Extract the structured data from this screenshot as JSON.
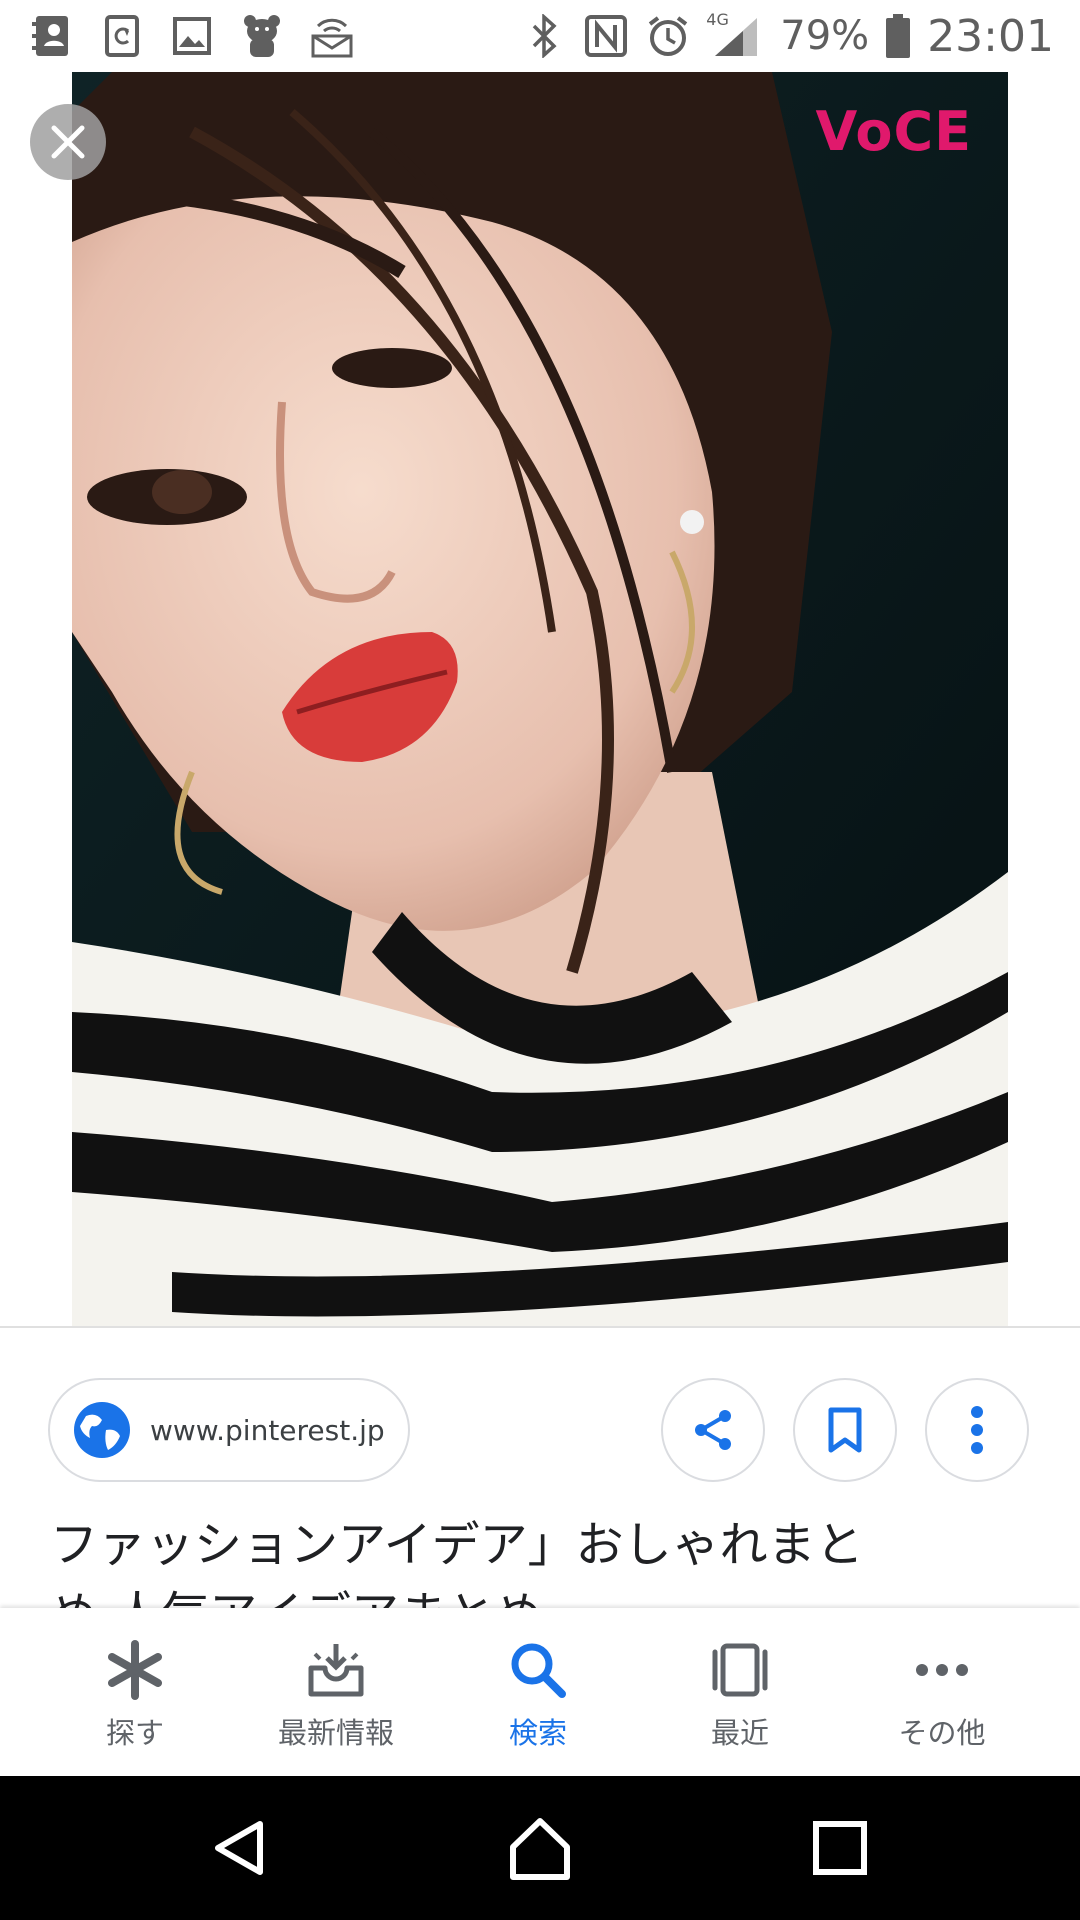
{
  "status_bar": {
    "network": "4G",
    "battery": "79%",
    "time": "23:01"
  },
  "viewer": {
    "brand_text": "VoCE",
    "close_label": "×"
  },
  "source": {
    "domain": "www.pinterest.jp"
  },
  "caption": {
    "line1": "ファッションアイデア」おしゃれまと",
    "line2": "め 人気アイデアまとめ"
  },
  "bottom_nav": {
    "items": [
      {
        "label": "探す",
        "icon": "asterisk-icon"
      },
      {
        "label": "最新情報",
        "icon": "inbox-icon"
      },
      {
        "label": "検索",
        "icon": "search-icon",
        "active": true
      },
      {
        "label": "最近",
        "icon": "recent-icon"
      },
      {
        "label": "その他",
        "icon": "more-horiz-icon"
      }
    ]
  },
  "colors": {
    "accent": "#1a73e8",
    "brand_pink": "#e0196c",
    "text_gray": "#5f6368"
  }
}
